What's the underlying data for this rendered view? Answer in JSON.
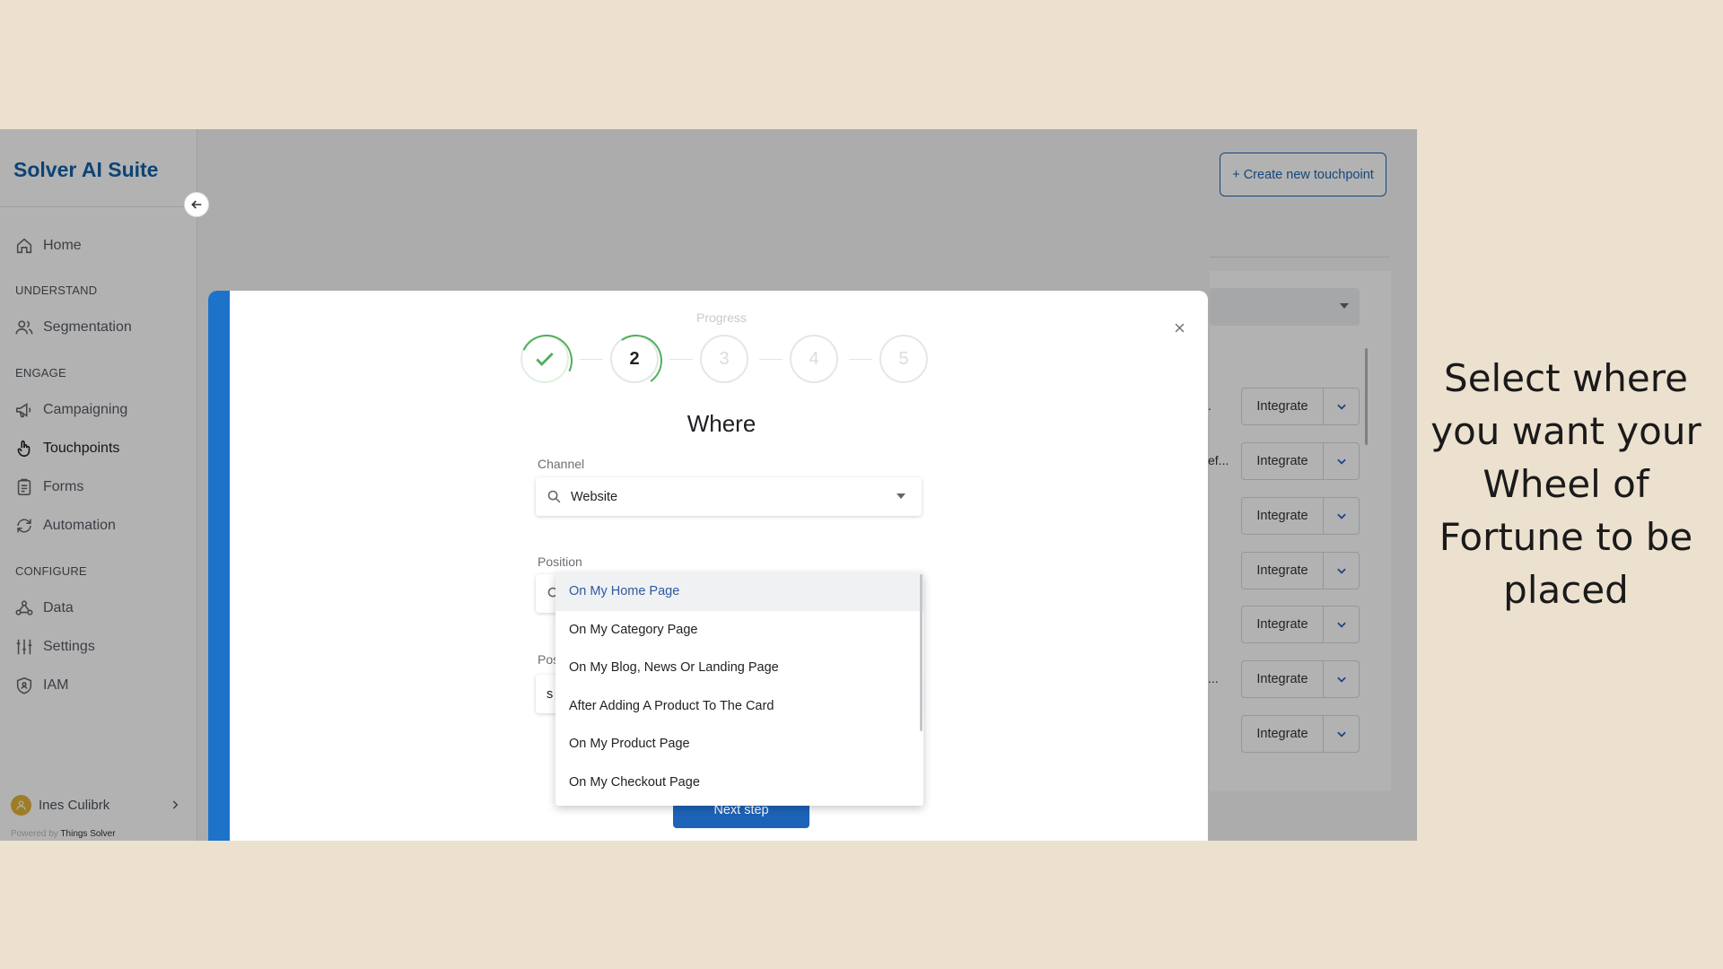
{
  "sidebar": {
    "brand": "Solver AI Suite",
    "sections": {
      "understand": "UNDERSTAND",
      "engage": "ENGAGE",
      "configure": "CONFIGURE"
    },
    "items": {
      "home": "Home",
      "segmentation": "Segmentation",
      "campaigning": "Campaigning",
      "touchpoints": "Touchpoints",
      "forms": "Forms",
      "automation": "Automation",
      "data": "Data",
      "settings": "Settings",
      "iam": "IAM"
    },
    "active_item": "Touchpoints",
    "user_name": "Ines Culibrk",
    "powered_by_prefix": "Powered by",
    "powered_by_name": "Things Solver"
  },
  "header": {
    "create_button": "+ Create new touchpoint"
  },
  "table": {
    "integrate_label": "Integrate",
    "row_fragments": [
      ".",
      "ef...",
      "",
      "",
      "",
      "...",
      ""
    ]
  },
  "modal": {
    "progress_label": "Progress",
    "steps": [
      "1",
      "2",
      "3",
      "4",
      "5"
    ],
    "completed_steps": 1,
    "current_step": 2,
    "title": "Where",
    "channel_label": "Channel",
    "channel_value": "Website",
    "position_label": "Position",
    "second_position_label_fragment": "Pos",
    "second_field_fragment": "s",
    "next_button": "Next step"
  },
  "dropdown": {
    "options": [
      "On My Home Page",
      "On My Category Page",
      "On My Blog, News Or Landing Page",
      "After Adding A Product To The Card",
      "On My Product Page",
      "On My Checkout Page"
    ],
    "highlighted_index": 0
  },
  "caption": {
    "text": "Select where you want your Wheel of Fortune to be placed"
  },
  "colors": {
    "background": "#ece1cf",
    "brand": "#1560a8",
    "accent": "#1d73c9",
    "progress_green": "#4eb05b",
    "button_blue": "#1d63b8"
  }
}
